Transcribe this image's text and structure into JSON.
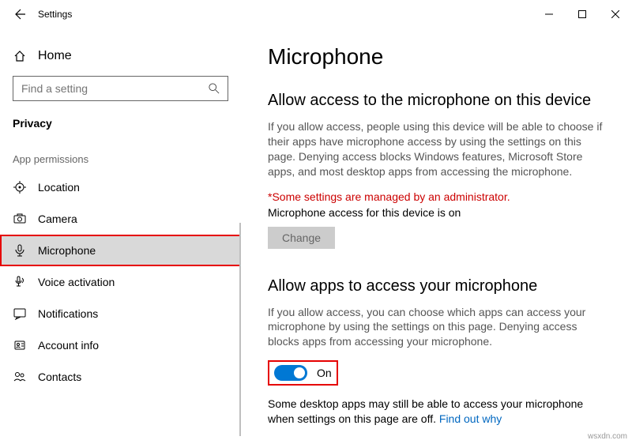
{
  "app": {
    "title": "Settings"
  },
  "sidebar": {
    "home": "Home",
    "search_placeholder": "Find a setting",
    "category": "Privacy",
    "section": "App permissions",
    "items": [
      {
        "icon": "location",
        "label": "Location"
      },
      {
        "icon": "camera",
        "label": "Camera"
      },
      {
        "icon": "mic",
        "label": "Microphone"
      },
      {
        "icon": "voice",
        "label": "Voice activation"
      },
      {
        "icon": "notif",
        "label": "Notifications"
      },
      {
        "icon": "account",
        "label": "Account info"
      },
      {
        "icon": "contacts",
        "label": "Contacts"
      }
    ]
  },
  "page": {
    "title": "Microphone",
    "s1": {
      "heading": "Allow access to the microphone on this device",
      "desc": "If you allow access, people using this device will be able to choose if their apps have microphone access by using the settings on this page. Denying access blocks Windows features, Microsoft Store apps, and most desktop apps from accessing the microphone.",
      "admin": "*Some settings are managed by an administrator.",
      "status": "Microphone access for this device is on",
      "change": "Change"
    },
    "s2": {
      "heading": "Allow apps to access your microphone",
      "desc": "If you allow access, you can choose which apps can access your microphone by using the settings on this page. Denying access blocks apps from accessing your microphone.",
      "toggle": "On",
      "desk_note": "Some desktop apps may still be able to access your microphone when settings on this page are off. ",
      "link": "Find out why"
    }
  },
  "watermark": "wsxdn.com"
}
